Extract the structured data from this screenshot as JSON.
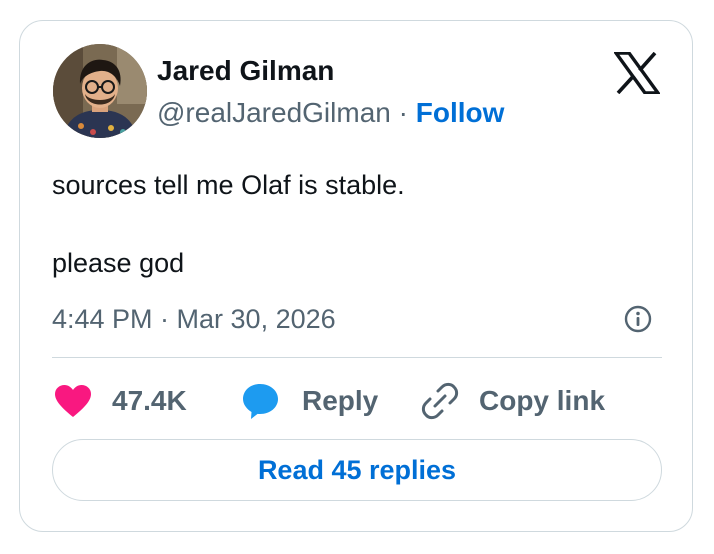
{
  "author": {
    "name": "Jared Gilman",
    "handle": "@realJaredGilman",
    "separator": " · ",
    "follow_label": "Follow"
  },
  "tweet": {
    "lines": [
      "sources tell me Olaf is stable.",
      "please god"
    ],
    "timestamp": "4:44 PM · Mar 30, 2026"
  },
  "actions": {
    "like_count": "47.4K",
    "reply_label": "Reply",
    "copy_link_label": "Copy link"
  },
  "read_replies_label": "Read 45 replies",
  "icons": {
    "brand": "x-logo-icon",
    "info": "info-icon",
    "like": "heart-icon",
    "reply": "speech-bubble-icon",
    "copy": "link-icon"
  },
  "colors": {
    "text": "#0f1419",
    "secondary": "#536471",
    "link": "#006fd6",
    "heart": "#f91880",
    "reply_bubble": "#1d9bf0",
    "border": "#cfd9de"
  }
}
